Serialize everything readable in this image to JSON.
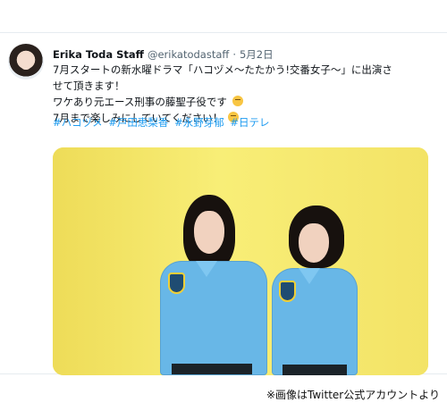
{
  "tweet": {
    "author_name": "Erika Toda Staff",
    "handle": "@erikatodastaff",
    "separator": "·",
    "date": "5月2日",
    "lines": [
      "7月スタートの新水曜ドラマ「ハコヅメ〜たたかう!交番女子〜」に出演さ",
      "せて頂きます！",
      "ワケあり元エース刑事の藤聖子役です",
      "7月まで楽しみにしていてください！"
    ],
    "hashtags": [
      "#ハコヅメ",
      "#戸田恵梨香",
      "#永野芽郁",
      "#日テレ"
    ]
  },
  "footer": {
    "credit": "※画像はTwitter公式アカウントより"
  },
  "colors": {
    "link": "#1d9bf0",
    "text": "#0f1419",
    "muted": "#536471",
    "photo_background": "#f1e86a",
    "uniform": "#68b7e7"
  }
}
